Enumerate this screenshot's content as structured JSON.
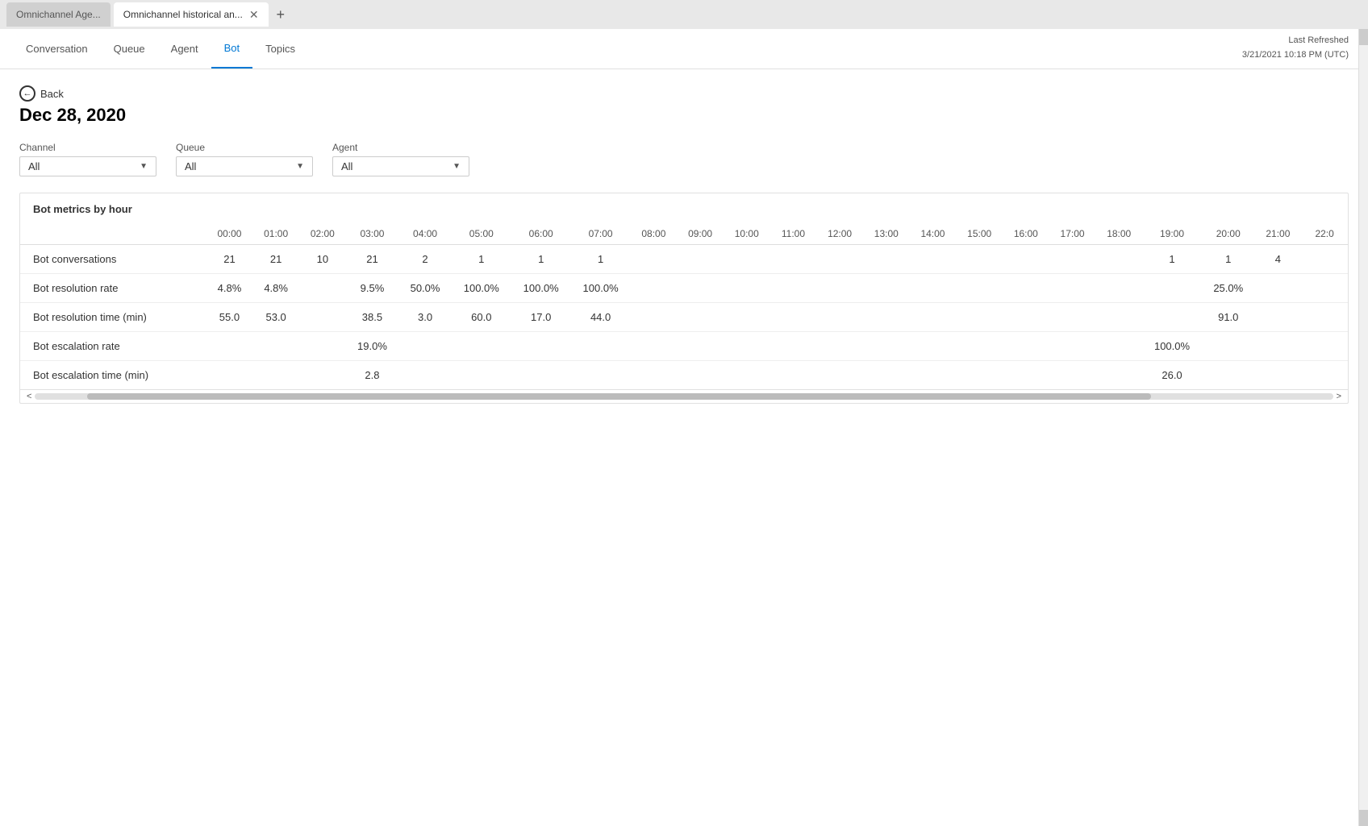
{
  "browser": {
    "tabs": [
      {
        "id": "tab1",
        "label": "Omnichannel Age...",
        "active": false
      },
      {
        "id": "tab2",
        "label": "Omnichannel historical an...",
        "active": true
      }
    ],
    "new_tab_icon": "+"
  },
  "nav": {
    "items": [
      {
        "id": "conversation",
        "label": "Conversation",
        "active": false
      },
      {
        "id": "queue",
        "label": "Queue",
        "active": false
      },
      {
        "id": "agent",
        "label": "Agent",
        "active": false
      },
      {
        "id": "bot",
        "label": "Bot",
        "active": true
      },
      {
        "id": "topics",
        "label": "Topics",
        "active": false
      }
    ],
    "last_refreshed_label": "Last Refreshed",
    "last_refreshed_value": "3/21/2021 10:18 PM (UTC)"
  },
  "page": {
    "back_label": "Back",
    "date_heading": "Dec 28, 2020"
  },
  "filters": {
    "channel": {
      "label": "Channel",
      "value": "All"
    },
    "queue": {
      "label": "Queue",
      "value": "All"
    },
    "agent": {
      "label": "Agent",
      "value": "All"
    }
  },
  "metrics_table": {
    "title": "Bot metrics by hour",
    "hours": [
      "00:00",
      "01:00",
      "02:00",
      "03:00",
      "04:00",
      "05:00",
      "06:00",
      "07:00",
      "08:00",
      "09:00",
      "10:00",
      "11:00",
      "12:00",
      "13:00",
      "14:00",
      "15:00",
      "16:00",
      "17:00",
      "18:00",
      "19:00",
      "20:00",
      "21:00",
      "22:0"
    ],
    "rows": [
      {
        "label": "Bot conversations",
        "values": [
          "21",
          "21",
          "10",
          "21",
          "2",
          "1",
          "1",
          "1",
          "",
          "",
          "",
          "",
          "",
          "",
          "",
          "",
          "",
          "",
          "",
          "1",
          "1",
          "4",
          ""
        ]
      },
      {
        "label": "Bot resolution rate",
        "values": [
          "4.8%",
          "4.8%",
          "",
          "9.5%",
          "50.0%",
          "100.0%",
          "100.0%",
          "100.0%",
          "",
          "",
          "",
          "",
          "",
          "",
          "",
          "",
          "",
          "",
          "",
          "",
          "25.0%",
          "",
          ""
        ]
      },
      {
        "label": "Bot resolution time (min)",
        "values": [
          "55.0",
          "53.0",
          "",
          "38.5",
          "3.0",
          "60.0",
          "17.0",
          "44.0",
          "",
          "",
          "",
          "",
          "",
          "",
          "",
          "",
          "",
          "",
          "",
          "",
          "91.0",
          "",
          ""
        ]
      },
      {
        "label": "Bot escalation rate",
        "values": [
          "",
          "",
          "",
          "19.0%",
          "",
          "",
          "",
          "",
          "",
          "",
          "",
          "",
          "",
          "",
          "",
          "",
          "",
          "",
          "",
          "100.0%",
          "",
          "",
          ""
        ]
      },
      {
        "label": "Bot escalation time (min)",
        "values": [
          "",
          "",
          "",
          "2.8",
          "",
          "",
          "",
          "",
          "",
          "",
          "",
          "",
          "",
          "",
          "",
          "",
          "",
          "",
          "",
          "26.0",
          "",
          "",
          ""
        ]
      }
    ]
  }
}
